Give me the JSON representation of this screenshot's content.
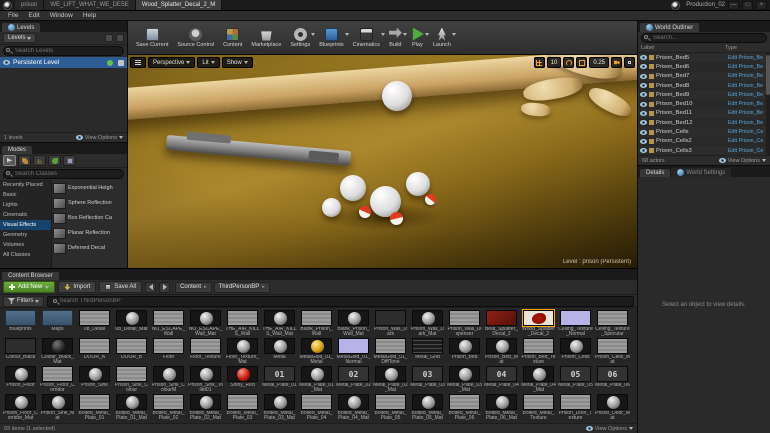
{
  "title_bar": {
    "tabs": [
      {
        "label": "prison"
      },
      {
        "label": "WE_LIFT_WHAT_WE_DESE"
      },
      {
        "label": "Wood_Splatter_Decal_2_M",
        "sel": "selected"
      }
    ],
    "project_name": "Production_02",
    "window_controls": {
      "minimize": "—",
      "maximize": "□",
      "close": "×"
    }
  },
  "menu_bar": {
    "items": [
      "File",
      "Edit",
      "Window",
      "Help"
    ]
  },
  "levels_panel": {
    "tab_label": "Levels",
    "dropdown_label": "Levels",
    "search_placeholder": "Search Levels",
    "rows": [
      {
        "name": "Persistent Level"
      }
    ],
    "footer_left": "1 levels",
    "footer_right": "View Options"
  },
  "modes_panel": {
    "tab_label": "Modes",
    "search_placeholder": "Search Classes",
    "categories": [
      {
        "label": "Recently Placed"
      },
      {
        "label": "Basic"
      },
      {
        "label": "Lights"
      },
      {
        "label": "Cinematic"
      },
      {
        "label": "Visual Effects",
        "sel": "selected"
      },
      {
        "label": "Geometry"
      },
      {
        "label": "Volumes"
      },
      {
        "label": "All Classes"
      }
    ],
    "items": [
      {
        "label": "Exponential Heigh"
      },
      {
        "label": "Sphere Reflection"
      },
      {
        "label": "Box Reflection Ca"
      },
      {
        "label": "Planar Reflection"
      },
      {
        "label": "Deferred Decal"
      }
    ]
  },
  "toolbar": {
    "buttons": [
      {
        "label": "Save Current",
        "icon": "save-current-icon"
      },
      {
        "label": "Source Control",
        "icon": "source-control-icon"
      },
      {
        "label": "Content",
        "icon": "content-icon"
      },
      {
        "label": "Marketplace",
        "icon": "marketplace-icon"
      },
      {
        "label": "Settings",
        "icon": "settings-icon",
        "dd": "has-dd"
      },
      {
        "label": "Blueprints",
        "icon": "blueprints-icon",
        "dd": "has-dd"
      },
      {
        "label": "Cinematics",
        "icon": "cinematics-icon",
        "dd": "has-dd"
      },
      {
        "label": "Build",
        "icon": "build-icon",
        "dd": "has-dd"
      },
      {
        "label": "Play",
        "icon": "play-icon",
        "dd": "has-dd"
      },
      {
        "label": "Launch",
        "icon": "launch-icon",
        "dd": "has-dd"
      }
    ]
  },
  "viewport": {
    "camera_label": "Perspective",
    "lit_label": "Lit",
    "show_label": "Show",
    "grid_snap_value": "10",
    "scale_snap_value": "0.25",
    "level_label": "Level : prison (Persistent)"
  },
  "world_outliner": {
    "tab_label": "World Outliner",
    "search_placeholder": "Search...",
    "columns": {
      "label": "Label",
      "type": "Type"
    },
    "rows": [
      {
        "label": "Prison_Bed5",
        "type": "Edit Prison_Be"
      },
      {
        "label": "Prison_Bed6",
        "type": "Edit Prison_Be"
      },
      {
        "label": "Prison_Bed7",
        "type": "Edit Prison_Be"
      },
      {
        "label": "Prison_Bed8",
        "type": "Edit Prison_Be"
      },
      {
        "label": "Prison_Bed9",
        "type": "Edit Prison_Be"
      },
      {
        "label": "Prison_Bed10",
        "type": "Edit Prison_Be"
      },
      {
        "label": "Prison_Bed11",
        "type": "Edit Prison_Be"
      },
      {
        "label": "Prison_Bed12",
        "type": "Edit Prison_Be"
      },
      {
        "label": "Prison_Cells",
        "type": "Edit Prison_Ce"
      },
      {
        "label": "Prison_Cells2",
        "type": "Edit Prison_Ce"
      },
      {
        "label": "Prison_Cells3",
        "type": "Edit Prison_Ce"
      }
    ],
    "footer_left": "68 actors",
    "footer_right": "View Options"
  },
  "details_panel": {
    "tab_details": "Details",
    "tab_world_settings": "World Settings",
    "empty_text": "Select an object to view details."
  },
  "content_browser": {
    "tab_label": "Content Browser",
    "add_new_label": "Add New",
    "import_label": "Import",
    "save_all_label": "Save All",
    "breadcrumb": [
      {
        "label": "Content"
      },
      {
        "label": "ThirdPersonBP"
      }
    ],
    "filters_label": "Filters",
    "search_placeholder": "Search ThirdPersonBP",
    "footer_left": "93 items (1 selected)",
    "footer_right": "View Options",
    "assets": [
      {
        "name": "Blueprints",
        "kind": "folder"
      },
      {
        "name": "Maps",
        "kind": "folder"
      },
      {
        "name": "08_Detail",
        "kind": "tex"
      },
      {
        "name": "08_Detail_Mat",
        "kind": "sphere"
      },
      {
        "name": "NO_ESCAPE_Wall",
        "kind": "tex"
      },
      {
        "name": "NO_ESCAPE_Wall_Mat",
        "kind": "sphere"
      },
      {
        "name": "THE_AIR_KILLS_Wall",
        "kind": "tex"
      },
      {
        "name": "THE_AIR_KILLS_Wall_Mat",
        "kind": "sphere"
      },
      {
        "name": "Blank_Prison_Wall",
        "kind": "tex"
      },
      {
        "name": "Blank_Prison_Wall_Mat",
        "kind": "sphere"
      },
      {
        "name": "Prison_Wall_Dark",
        "kind": "tex-dark"
      },
      {
        "name": "Prison_Wall_Dark_Mat",
        "kind": "sphere"
      },
      {
        "name": "Prison_Wall_Dispenser",
        "kind": "tex"
      },
      {
        "name": "Beat_Splatter_Decal_2",
        "kind": "tex-red"
      },
      {
        "name": "Wood_Splatter_Decal_2",
        "kind": "splat",
        "sel": "selected"
      },
      {
        "name": "Ceiling_Texture_Normal",
        "kind": "tex-lav"
      },
      {
        "name": "Ceiling_Texture_Specular",
        "kind": "tex"
      },
      {
        "name": "Colour_Black",
        "kind": "tex-dark"
      },
      {
        "name": "Colour_Black_Mat",
        "kind": "sphere-dark"
      },
      {
        "name": "DOOR_A",
        "kind": "tex"
      },
      {
        "name": "DOOR_B",
        "kind": "tex"
      },
      {
        "name": "Floor",
        "kind": "tex"
      },
      {
        "name": "Floor_Texture",
        "kind": "tex"
      },
      {
        "name": "Floor_Texture_Mat",
        "kind": "sphere"
      },
      {
        "name": "Metal",
        "kind": "sphere"
      },
      {
        "name": "MetalGold_01_Metal",
        "kind": "sphere-yellow"
      },
      {
        "name": "MetalGold_01_Normal",
        "kind": "tex-lav"
      },
      {
        "name": "MetalGold_01_DiffTone",
        "kind": "tex"
      },
      {
        "name": "Metal_Grid",
        "kind": "tex-grid"
      },
      {
        "name": "Prison_Bed",
        "kind": "sphere"
      },
      {
        "name": "Prison_Bed_Mat",
        "kind": "sphere"
      },
      {
        "name": "Prison_Bed_Texture",
        "kind": "tex"
      },
      {
        "name": "Prison_Cells",
        "kind": "sphere"
      },
      {
        "name": "Prison_Cells_Mat",
        "kind": "tex"
      },
      {
        "name": "Prison_Floor",
        "kind": "sphere"
      },
      {
        "name": "Prison_Floor_Corridor",
        "kind": "tex"
      },
      {
        "name": "Prison_Sink",
        "kind": "sphere"
      },
      {
        "name": "Prison_Sink_Colour",
        "kind": "tex"
      },
      {
        "name": "Prison_Sink_ColourM",
        "kind": "sphere"
      },
      {
        "name": "Prison_Sink_Toilet01",
        "kind": "sphere"
      },
      {
        "name": "Shiny_Red",
        "kind": "sphere-red"
      },
      {
        "name": "Metal_Plate_01",
        "kind": "number",
        "num": "01"
      },
      {
        "name": "Metal_Plate_01_Mat",
        "kind": "sphere"
      },
      {
        "name": "Metal_Plate_02",
        "kind": "number",
        "num": "02"
      },
      {
        "name": "Metal_Plate_02_Mat",
        "kind": "sphere"
      },
      {
        "name": "Metal_Plate_03",
        "kind": "number",
        "num": "03"
      },
      {
        "name": "Metal_Plate_03_Mat",
        "kind": "sphere"
      },
      {
        "name": "Metal_Plate_04",
        "kind": "number",
        "num": "04"
      },
      {
        "name": "Metal_Plate_04_Mat",
        "kind": "sphere"
      },
      {
        "name": "Metal_Plate_05",
        "kind": "number",
        "num": "05"
      },
      {
        "name": "Metal_Plate_06",
        "kind": "number",
        "num": "06"
      },
      {
        "name": "Prison_Floor_Corridor_Mat",
        "kind": "sphere"
      },
      {
        "name": "Prison_Sink_Mat",
        "kind": "sphere"
      },
      {
        "name": "Bolted_Metal_Plate_01",
        "kind": "tex"
      },
      {
        "name": "Bolted_Metal_Plate_01_Mat",
        "kind": "sphere"
      },
      {
        "name": "Bolted_Metal_Plate_02",
        "kind": "tex"
      },
      {
        "name": "Bolted_Metal_Plate_02_Mat",
        "kind": "sphere"
      },
      {
        "name": "Bolted_Metal_Plate_03",
        "kind": "tex"
      },
      {
        "name": "Bolted_Metal_Plate_03_Mat",
        "kind": "sphere"
      },
      {
        "name": "Bolted_Metal_Plate_04",
        "kind": "tex"
      },
      {
        "name": "Bolted_Metal_Plate_04_Mat",
        "kind": "sphere"
      },
      {
        "name": "Bolted_Metal_Plate_05",
        "kind": "tex"
      },
      {
        "name": "Bolted_Metal_Plate_05_Mat",
        "kind": "sphere"
      },
      {
        "name": "Bolted_Metal_Plate_06",
        "kind": "tex"
      },
      {
        "name": "Bolted_Metal_Plate_06_Mat",
        "kind": "sphere"
      },
      {
        "name": "Bolted_Metal_Texture",
        "kind": "tex"
      },
      {
        "name": "Prison_Door_Texture",
        "kind": "tex"
      },
      {
        "name": "Prison_Door_Mat",
        "kind": "sphere"
      }
    ]
  }
}
